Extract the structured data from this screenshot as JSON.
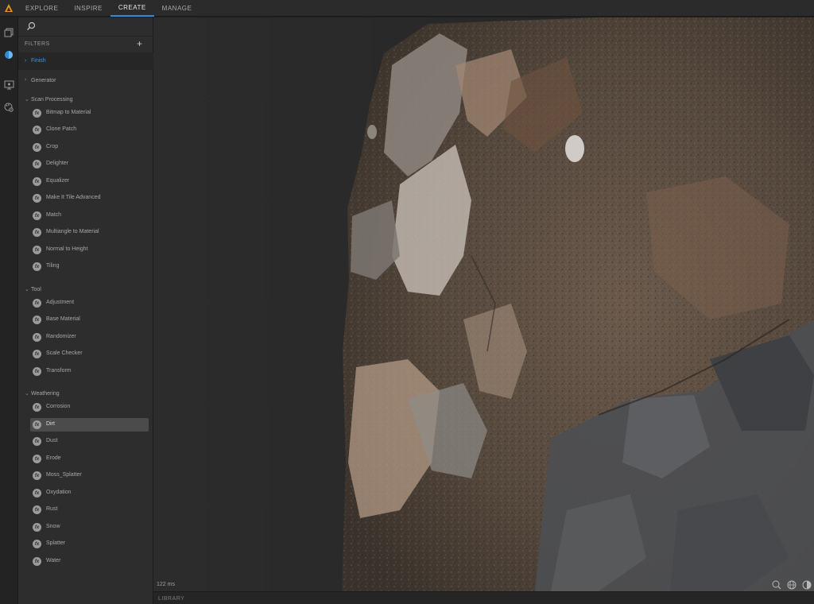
{
  "nav": {
    "tabs": [
      {
        "label": "EXPLORE"
      },
      {
        "label": "INSPIRE"
      },
      {
        "label": "CREATE"
      },
      {
        "label": "MANAGE"
      }
    ],
    "active_tab": "CREATE"
  },
  "rail": {
    "icons": [
      "library-icon",
      "material-icon",
      "viewport-icon",
      "settings-palette-icon"
    ]
  },
  "filters": {
    "title": "FILTERS",
    "finish_label": "Finish",
    "categories": [
      {
        "label": "Generator",
        "expanded": false,
        "items": []
      },
      {
        "label": "Scan Processing",
        "expanded": true,
        "items": [
          "Bitmap to Material",
          "Clone Patch",
          "Crop",
          "Delighter",
          "Equalizer",
          "Make It Tile Advanced",
          "Match",
          "Multiangle to Material",
          "Normal to Height",
          "Tiling"
        ]
      },
      {
        "label": "Tool",
        "expanded": true,
        "items": [
          "Adjustment",
          "Base Material",
          "Randomizer",
          "Scale Checker",
          "Transform"
        ]
      },
      {
        "label": "Weathering",
        "expanded": true,
        "items": [
          "Corrosion",
          "Dirt",
          "Dust",
          "Erode",
          "Moss_Splatter",
          "Oxydation",
          "Rust",
          "Snow",
          "Splatter",
          "Water"
        ]
      }
    ],
    "selected_item": "Dirt",
    "fx_glyph": "fx"
  },
  "viewport": {
    "render_time": "122 ms",
    "tools": [
      "zoom-icon",
      "environment-icon",
      "camera-reset-icon"
    ]
  },
  "library": {
    "label": "LIBRARY"
  },
  "colors": {
    "accent": "#2d8ce0",
    "finish_link": "#3c97e6",
    "selected_row": "#4b4b4b"
  }
}
